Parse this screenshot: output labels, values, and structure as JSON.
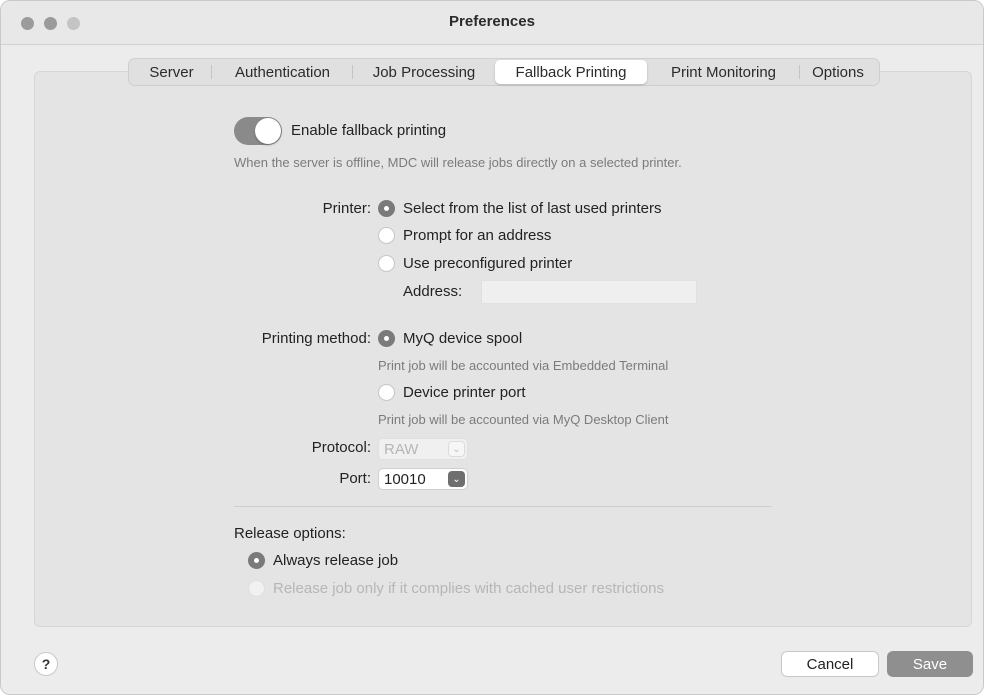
{
  "window": {
    "title": "Preferences"
  },
  "tabs": [
    {
      "label": "Server"
    },
    {
      "label": "Authentication"
    },
    {
      "label": "Job Processing"
    },
    {
      "label": "Fallback Printing"
    },
    {
      "label": "Print Monitoring"
    },
    {
      "label": "Options"
    }
  ],
  "active_tab": "Fallback Printing",
  "fallback": {
    "enable_label": "Enable fallback printing",
    "enabled": true,
    "description": "When the server is offline, MDC will release jobs directly on a selected printer."
  },
  "printer": {
    "label": "Printer:",
    "options": [
      {
        "label": "Select from the list of last used printers",
        "selected": true
      },
      {
        "label": "Prompt for an address",
        "selected": false
      },
      {
        "label": "Use preconfigured printer",
        "selected": false
      }
    ],
    "address_label": "Address:",
    "address_value": ""
  },
  "printing_method": {
    "label": "Printing method:",
    "options": [
      {
        "label": "MyQ device spool",
        "hint": "Print job will be accounted via Embedded Terminal",
        "selected": true
      },
      {
        "label": "Device printer port",
        "hint": "Print job will be accounted via MyQ Desktop Client",
        "selected": false
      }
    ],
    "protocol_label": "Protocol:",
    "protocol_value": "RAW",
    "port_label": "Port:",
    "port_value": "10010"
  },
  "release": {
    "label": "Release options:",
    "options": [
      {
        "label": "Always release job",
        "selected": true,
        "enabled": true
      },
      {
        "label": "Release job only if it complies with cached user restrictions",
        "selected": false,
        "enabled": false
      }
    ]
  },
  "footer": {
    "help_label": "?",
    "cancel_label": "Cancel",
    "save_label": "Save"
  },
  "colors": {
    "toggle_on": "#8a8a8a",
    "save_button": "#8f8f8f"
  }
}
